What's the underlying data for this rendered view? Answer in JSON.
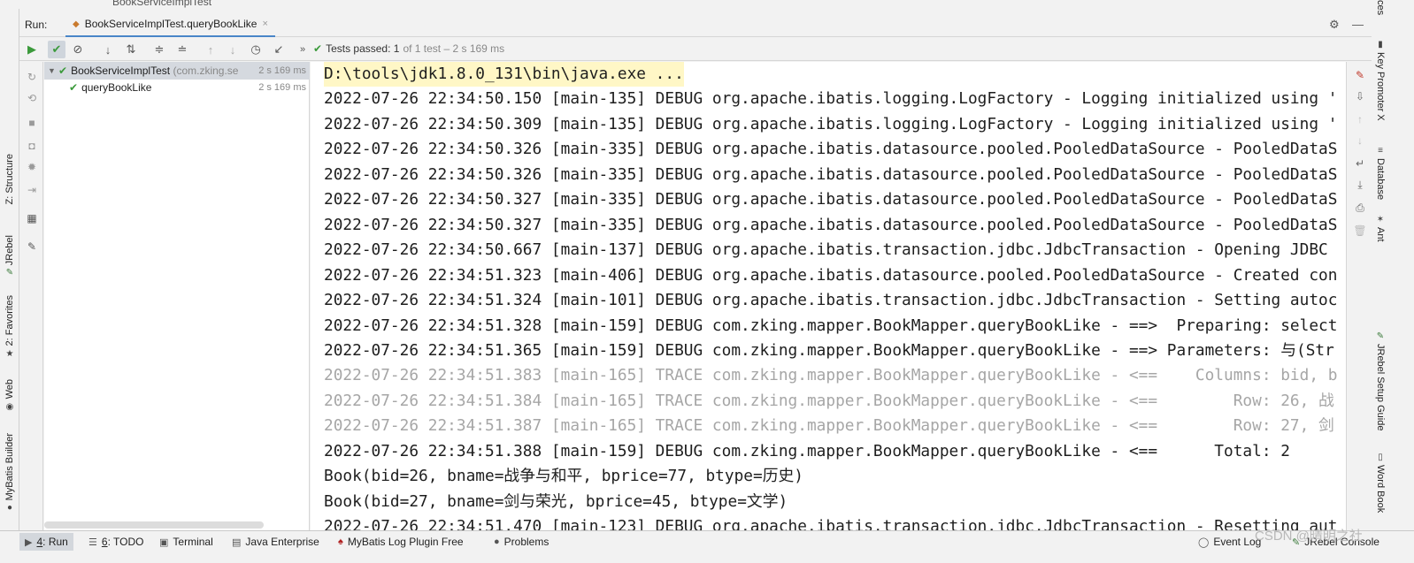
{
  "crumb": "BookServiceImplTest",
  "run": {
    "label": "Run:",
    "tab_title": "BookServiceImplTest.queryBookLike",
    "close_glyph": "×"
  },
  "status": {
    "passed": "Tests passed: 1",
    "detail": "of 1 test – 2 s 169 ms"
  },
  "tree": {
    "root_name": "BookServiceImplTest",
    "root_pkg": "(com.zking.se",
    "root_time": "2 s 169 ms",
    "child_name": "queryBookLike",
    "child_time": "2 s 169 ms"
  },
  "console": {
    "cmd": "D:\\tools\\jdk1.8.0_131\\bin\\java.exe ...",
    "lines": [
      "2022-07-26 22:34:50.150 [main-135] DEBUG org.apache.ibatis.logging.LogFactory - Logging initialized using '",
      "2022-07-26 22:34:50.309 [main-135] DEBUG org.apache.ibatis.logging.LogFactory - Logging initialized using '",
      "2022-07-26 22:34:50.326 [main-335] DEBUG org.apache.ibatis.datasource.pooled.PooledDataSource - PooledDataS",
      "2022-07-26 22:34:50.326 [main-335] DEBUG org.apache.ibatis.datasource.pooled.PooledDataSource - PooledDataS",
      "2022-07-26 22:34:50.327 [main-335] DEBUG org.apache.ibatis.datasource.pooled.PooledDataSource - PooledDataS",
      "2022-07-26 22:34:50.327 [main-335] DEBUG org.apache.ibatis.datasource.pooled.PooledDataSource - PooledDataS",
      "2022-07-26 22:34:50.667 [main-137] DEBUG org.apache.ibatis.transaction.jdbc.JdbcTransaction - Opening JDBC",
      "2022-07-26 22:34:51.323 [main-406] DEBUG org.apache.ibatis.datasource.pooled.PooledDataSource - Created con",
      "2022-07-26 22:34:51.324 [main-101] DEBUG org.apache.ibatis.transaction.jdbc.JdbcTransaction - Setting autoc",
      "2022-07-26 22:34:51.328 [main-159] DEBUG com.zking.mapper.BookMapper.queryBookLike - ==>  Preparing: select",
      "2022-07-26 22:34:51.365 [main-159] DEBUG com.zking.mapper.BookMapper.queryBookLike - ==> Parameters: 与(Str"
    ],
    "trace_lines": [
      "2022-07-26 22:34:51.383 [main-165] TRACE com.zking.mapper.BookMapper.queryBookLike - <==    Columns: bid, b",
      "2022-07-26 22:34:51.384 [main-165] TRACE com.zking.mapper.BookMapper.queryBookLike - <==        Row: 26, 战",
      "2022-07-26 22:34:51.387 [main-165] TRACE com.zking.mapper.BookMapper.queryBookLike - <==        Row: 27, 剑"
    ],
    "total_line": "2022-07-26 22:34:51.388 [main-159] DEBUG com.zking.mapper.BookMapper.queryBookLike - <==      Total: 2",
    "book_lines": [
      "Book(bid=26, bname=战争与和平, bprice=77, btype=历史)",
      "Book(bid=27, bname=剑与荣光, bprice=45, btype=文学)"
    ],
    "last_line": "2022-07-26 22:34:51.470 [main-123] DEBUG org.apache.ibatis.transaction.jdbc.JdbcTransaction - Resetting aut"
  },
  "left_tabs": {
    "structure": "Z: Structure",
    "jrebel": "JRebel",
    "favorites": "2: Favorites",
    "web": "Web",
    "mybatis": "MyBatis Builder"
  },
  "right_tabs": {
    "key_promoter": "Key Promoter X",
    "database": "Database",
    "ant": "Ant",
    "jrebel_setup": "JRebel Setup Guide",
    "word_book": "Word Book",
    "top_clip": "ces"
  },
  "bottom": {
    "run_num": "4",
    "run_text": ": Run",
    "todo_num": "6",
    "todo_text": ": TODO",
    "terminal": "Terminal",
    "java_enterprise": "Java Enterprise",
    "mybatis_log": "MyBatis Log Plugin Free",
    "problems": "Problems",
    "event_log": "Event Log",
    "jrebel_console": "JRebel Console",
    "watermark": "CSDN @晴明之社"
  },
  "colors": {
    "accent": "#4a86c8",
    "pass_green": "#3b9a3b",
    "trace_gray": "#a6a6a6",
    "cmd_highlight": "#fff7c6"
  }
}
